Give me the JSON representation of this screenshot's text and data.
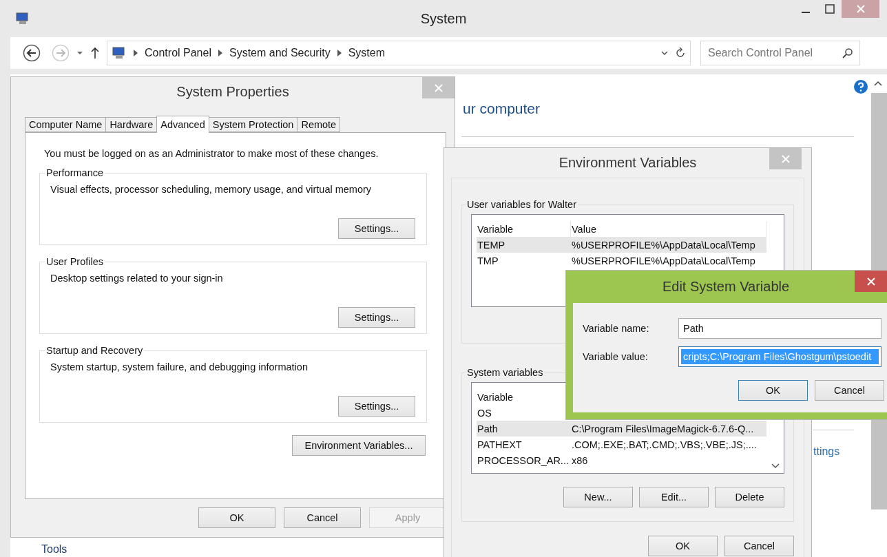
{
  "window": {
    "title": "System"
  },
  "address_bar": {
    "breadcrumbs": [
      "Control Panel",
      "System and Security",
      "System"
    ],
    "search": {
      "placeholder": "Search Control Panel"
    }
  },
  "content": {
    "heading": "ur computer",
    "link": "ttings",
    "footer_link": "Tools"
  },
  "system_properties": {
    "title": "System Properties",
    "tabs": [
      {
        "label": "Computer Name",
        "selected": false
      },
      {
        "label": "Hardware",
        "selected": false
      },
      {
        "label": "Advanced",
        "selected": true
      },
      {
        "label": "System Protection",
        "selected": false
      },
      {
        "label": "Remote",
        "selected": false
      }
    ],
    "notice": "You must be logged on as an Administrator to make most of these changes.",
    "groups": [
      {
        "title": "Performance",
        "description": "Visual effects, processor scheduling, memory usage, and virtual memory",
        "button": "Settings..."
      },
      {
        "title": "User Profiles",
        "description": "Desktop settings related to your sign-in",
        "button": "Settings..."
      },
      {
        "title": "Startup and Recovery",
        "description": "System startup, system failure, and debugging information",
        "button": "Settings..."
      }
    ],
    "env_button": "Environment Variables...",
    "buttons": [
      {
        "label": "OK",
        "disabled": false
      },
      {
        "label": "Cancel",
        "disabled": false
      },
      {
        "label": "Apply",
        "disabled": true
      }
    ]
  },
  "environment_variables": {
    "title": "Environment Variables",
    "user_group": {
      "title": "User variables for Walter",
      "columns": [
        "Variable",
        "Value"
      ],
      "rows": [
        {
          "variable": "TEMP",
          "value": "%USERPROFILE%\\AppData\\Local\\Temp",
          "selected": true
        },
        {
          "variable": "TMP",
          "value": "%USERPROFILE%\\AppData\\Local\\Temp",
          "selected": false
        }
      ]
    },
    "system_group": {
      "title": "System variables",
      "columns": [
        "Variable"
      ],
      "rows": [
        {
          "variable": "OS",
          "selected": false
        },
        {
          "variable": "Path",
          "value": "C:\\Program Files\\ImageMagick-6.7.6-Q...",
          "selected": true
        },
        {
          "variable": "PATHEXT",
          "value": ".COM;.EXE;.BAT;.CMD;.VBS;.VBE;.JS;....",
          "selected": false
        },
        {
          "variable": "PROCESSOR_AR...",
          "value": "x86",
          "selected": false
        }
      ],
      "buttons": [
        "New...",
        "Edit...",
        "Delete"
      ]
    },
    "buttons": [
      "OK",
      "Cancel"
    ]
  },
  "edit_dialog": {
    "title": "Edit System Variable",
    "fields": [
      {
        "label": "Variable name:",
        "value": "Path",
        "selected": false
      },
      {
        "label": "Variable value:",
        "value": "cripts;C:\\Program Files\\Ghostgum\\pstoedit",
        "selected": true
      }
    ],
    "buttons": [
      {
        "label": "OK",
        "default": true
      },
      {
        "label": "Cancel",
        "default": false
      }
    ]
  }
}
